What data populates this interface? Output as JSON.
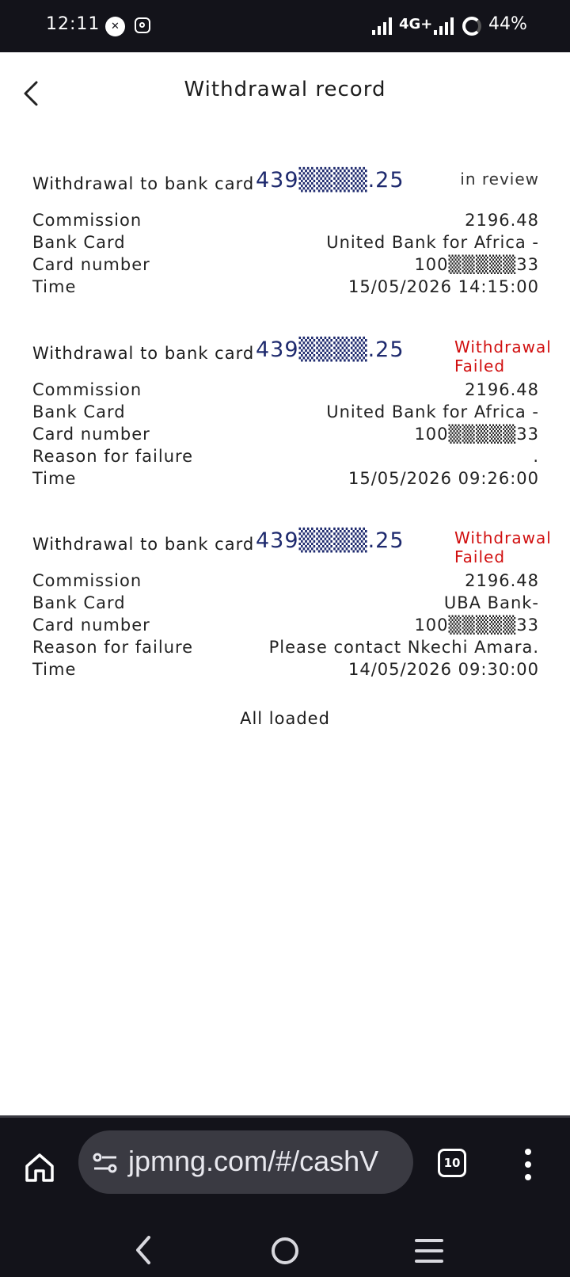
{
  "status_bar": {
    "time": "12:11",
    "network": "4G+",
    "battery": "44%"
  },
  "header": {
    "title": "Withdrawal record"
  },
  "labels": {
    "commission": "Commission",
    "bank_card": "Bank Card",
    "card_number": "Card number",
    "reason": "Reason for failure",
    "time": "Time"
  },
  "records": [
    {
      "title": "Withdrawal to bank card",
      "card": "439▒▒▒▒.25",
      "status": "in review",
      "commission": "2196.48",
      "bank": "United Bank for Africa -",
      "card_number": "100▒▒▒▒▒33",
      "time": "15/05/2026 14:15:00"
    },
    {
      "title": "Withdrawal to bank card",
      "card": "439▒▒▒▒.25",
      "status": "Withdrawal Failed",
      "commission": "2196.48",
      "bank": "United Bank for Africa -",
      "card_number": "100▒▒▒▒▒33",
      "reason": ".",
      "time": "15/05/2026 09:26:00"
    },
    {
      "title": "Withdrawal to bank card",
      "card": "439▒▒▒▒.25",
      "status": "Withdrawal Failed",
      "commission": "2196.48",
      "bank": "UBA Bank-",
      "card_number": "100▒▒▒▒▒33",
      "reason": "Please contact Nkechi Amara.",
      "time": "14/05/2026 09:30:00"
    }
  ],
  "footer": {
    "loaded": "All loaded"
  },
  "browser": {
    "url": "jpmng.com/#/cashV",
    "tab_count": "10"
  },
  "colors": {
    "card_accent": "#1e2a6e",
    "failed_red": "#d10f0f",
    "bar_bg": "#13131a"
  }
}
